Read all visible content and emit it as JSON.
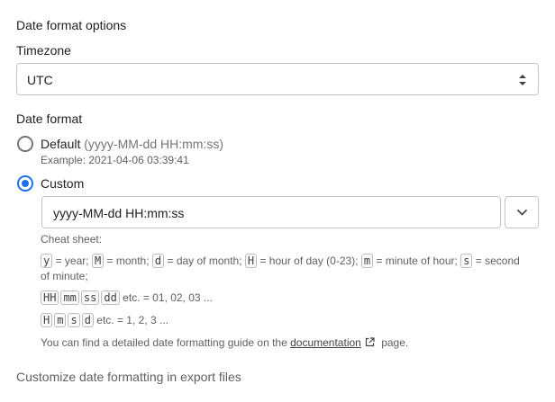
{
  "section_title": "Date format options",
  "timezone": {
    "label": "Timezone",
    "selected": "UTC"
  },
  "date_format": {
    "label": "Date format",
    "default": {
      "label": "Default",
      "pattern": "(yyyy-MM-dd HH:mm:ss)",
      "example": "Example: 2021-04-06 03:39:41",
      "selected": false
    },
    "custom": {
      "label": "Custom",
      "selected": true,
      "value": "yyyy-MM-dd HH:mm:ss"
    }
  },
  "cheat_sheet": {
    "title": "Cheat sheet:",
    "line1": [
      {
        "code": "y",
        "desc": "= year;"
      },
      {
        "code": "M",
        "desc": "= month;"
      },
      {
        "code": "d",
        "desc": "= day of month;"
      },
      {
        "code": "H",
        "desc": "= hour of day (0-23);"
      },
      {
        "code": "m",
        "desc": "= minute of hour;"
      },
      {
        "code": "s",
        "desc": "= second"
      }
    ],
    "line1_cont": "of minute;",
    "line2_codes": [
      "HH",
      "mm",
      "ss",
      "dd"
    ],
    "line2_desc": "etc. = 01, 02, 03 ...",
    "line3_codes": [
      "H",
      "m",
      "s",
      "d"
    ],
    "line3_desc": "etc. = 1, 2, 3 ...",
    "guide_prefix": "You can find a detailed date formatting guide on the",
    "guide_link": "documentation",
    "guide_suffix": "page."
  },
  "footer_title": "Customize date formatting in export files",
  "colors": {
    "accent": "#1a73e8",
    "border": "#c4c4c4"
  }
}
